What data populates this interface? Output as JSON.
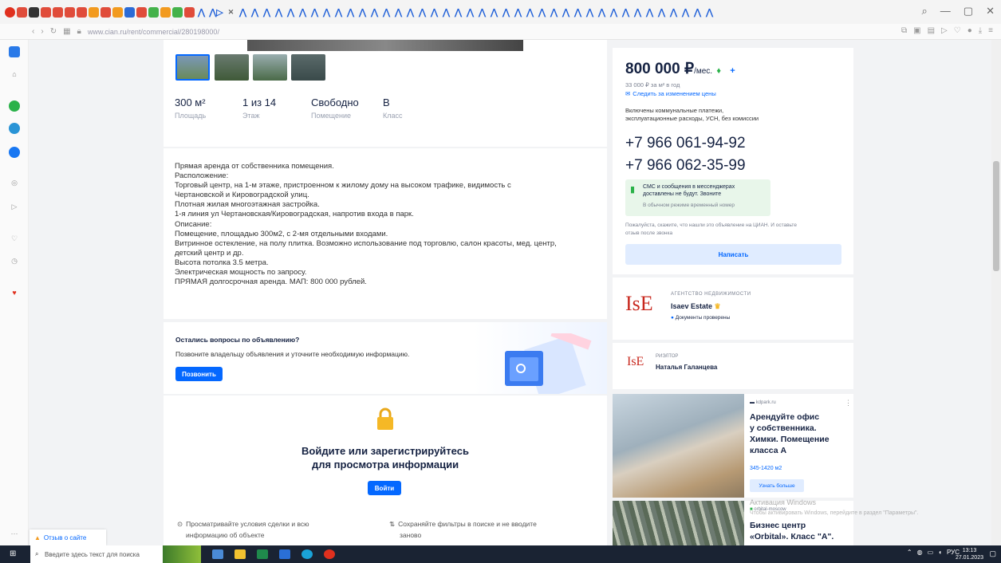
{
  "browser": {
    "url": "www.cian.ru/rent/commercial/280198000/",
    "feedback_label": "Отзыв о сайте"
  },
  "listing": {
    "params": [
      {
        "value": "300 м²",
        "label": "Площадь"
      },
      {
        "value": "1 из 14",
        "label": "Этаж"
      },
      {
        "value": "Свободно",
        "label": "Помещение"
      },
      {
        "value": "В",
        "label": "Класс"
      }
    ],
    "description": [
      "Прямая аренда от собственника помещения.",
      "Расположение:",
      "Торговый центр, на 1-м этаже, пристроенном к жилому дому на высоком трафике, видимость с",
      "Чертановской и Кировоградской улиц.",
      "Плотная жилая многоэтажная застройка.",
      "1-я линия ул Чертановская/Кировоградская, напротив входа в парк.",
      "Описание:",
      "Помещение, площадью 300м2, с 2-мя отдельными входами.",
      "Витринное остекление, на полу плитка. Возможно использование под торговлю, салон красоты, мед. центр,",
      "детский центр и др.",
      "Высота потолка 3.5 метра.",
      "Электрическая мощность по запросу.",
      "ПРЯМАЯ долгосрочная аренда. МАП: 800 000 рублей."
    ],
    "questions": {
      "title": "Остались вопросы по объявлению?",
      "text": "Позвоните владельцу объявления и уточните необходимую информацию.",
      "button": "Позвонить"
    },
    "login": {
      "title_line1": "Войдите или зарегистрируйтесь",
      "title_line2": "для просмотра информации",
      "button": "Войти",
      "benefit1_line1": "Просматривайте условия сделки и всю",
      "benefit1_line2": "информацию об объекте",
      "benefit2_line1": "Сохраняйте фильтры в поиске и не вводите",
      "benefit2_line2": "заново"
    }
  },
  "sidebar": {
    "price": "800 000 ₽",
    "price_unit": "/мес.",
    "price_per_m2": "33 000 ₽ за м² в год",
    "price_watch": "Следить за изменением цены",
    "price_includes_1": "Включены коммунальные платежи,",
    "price_includes_2": "эксплуатационные расходы, УСН, без комиссии",
    "phone1": "+7 966 061-94-92",
    "phone2": "+7 966 062-35-99",
    "sms_notice_1": "СМС и сообщения в мессенджерах",
    "sms_notice_2": "доставлены не будут. Звоните",
    "sms_notice_3": "В обычном режиме временный номер",
    "feedback_1": "Пожалуйста, скажите, что нашли это объявление на ЦИАН. И оставьте",
    "feedback_2": "отзыв после звонка",
    "write_button": "Написать",
    "agency_kind": "АГЕНТСТВО НЕДВИЖИМОСТИ",
    "agency_name": "Isaev Estate",
    "agency_verified": "Документы проверены",
    "agency_logo": "IsE",
    "realtor_kind": "РИЭЛТОР",
    "realtor_name": "Наталья Галанцева",
    "realtor_logo": "IsE"
  },
  "ads": [
    {
      "source": "kdpark.ru",
      "title_lines": [
        "Арендуйте офис",
        "у собственника.",
        "Химки. Помещение",
        "класса А"
      ],
      "price": "345-1420 м2",
      "button": "Узнать больше"
    },
    {
      "source": "orbital-moscow",
      "title_lines": [
        "Бизнес центр",
        "«Orbital». Класс \"А\"."
      ]
    }
  ],
  "windows_watermark": "Активация Windows",
  "windows_watermark_sub": "Чтобы активировать Windows, перейдите в раздел \"Параметры\".",
  "taskbar": {
    "search_placeholder": "Введите здесь текст для поиска",
    "lang": "РУС",
    "time": "13:13",
    "date": "27.01.2023"
  }
}
